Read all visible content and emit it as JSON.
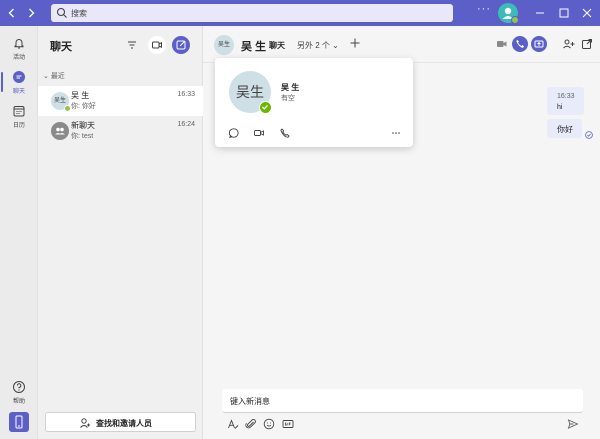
{
  "titlebar": {
    "search_placeholder": "搜索",
    "more": "···"
  },
  "rail": {
    "items": [
      {
        "label": "活动",
        "icon": "bell-icon"
      },
      {
        "label": "聊天",
        "icon": "chat-icon",
        "active": true
      },
      {
        "label": "日历",
        "icon": "calendar-icon"
      }
    ],
    "help_label": "帮助"
  },
  "chatlist": {
    "title": "聊天",
    "section": "最近",
    "chats": [
      {
        "avatar": "吴生",
        "name": "吴 生",
        "preview": "你: 你好",
        "time": "16:33"
      },
      {
        "avatar": "",
        "name": "新聊天",
        "preview": "你: test",
        "time": "16:24"
      }
    ],
    "invite_label": "查找和邀请人员"
  },
  "header": {
    "avatar_initials": "吴生",
    "name": "吴 生",
    "tab": "聊天",
    "others": "另外 2 个"
  },
  "profile_card": {
    "avatar_initials": "吴生",
    "name": "吴 生",
    "status": "有空"
  },
  "messages": [
    {
      "time": "16:33",
      "text": "hi"
    },
    {
      "text": "你好"
    }
  ],
  "compose": {
    "placeholder": "键入新消息"
  },
  "colors": {
    "brand": "#5b5fc7",
    "presence_available": "#92c353",
    "profile_check": "#6bb700",
    "title_avatar": "#3dbbb8"
  }
}
